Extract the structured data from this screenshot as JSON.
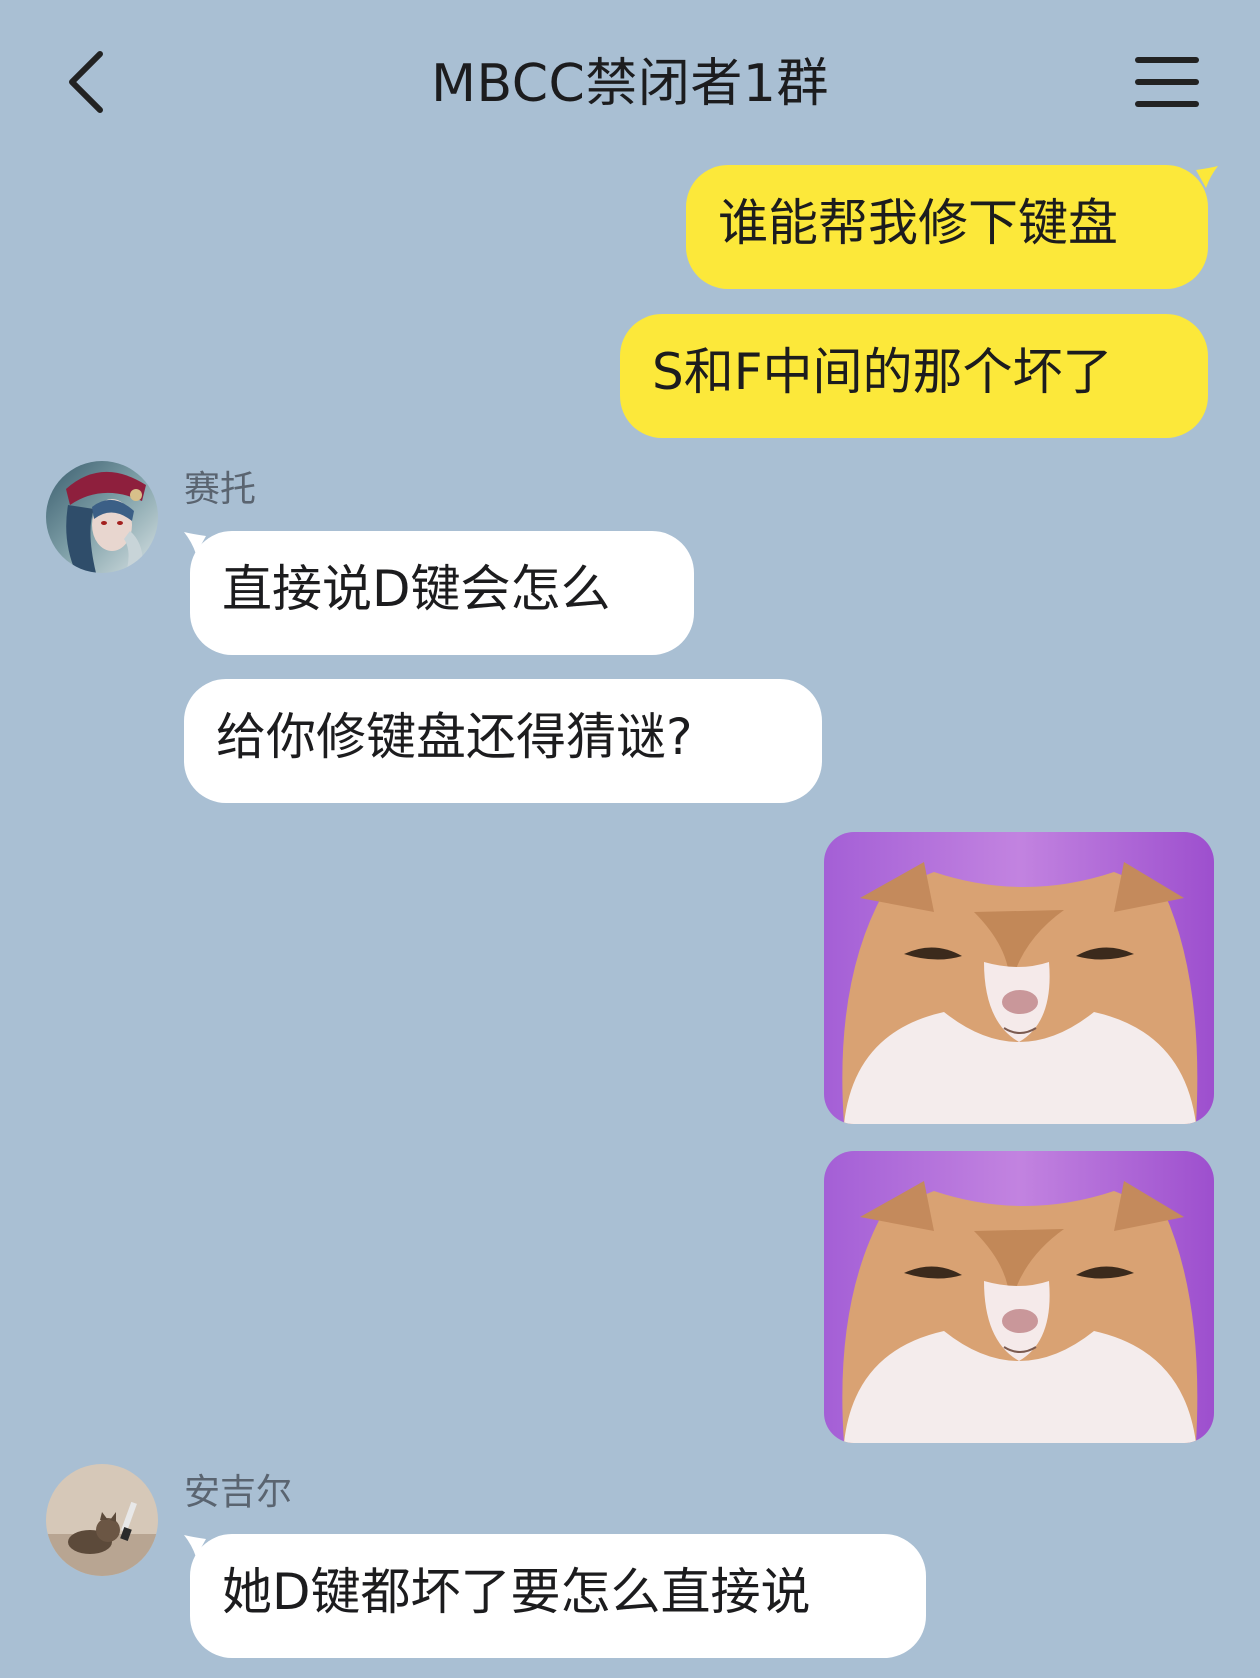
{
  "header": {
    "title": "MBCC禁闭者1群",
    "back_icon": "chevron-left-icon",
    "menu_icon": "hamburger-menu-icon"
  },
  "messages": [
    {
      "direction": "out",
      "text": "谁能帮我修下键盘"
    },
    {
      "direction": "out",
      "text": "S和F中间的那个坏了"
    },
    {
      "direction": "in",
      "sender": "赛托",
      "text": "直接说D键会怎么"
    },
    {
      "direction": "in",
      "text": "给你修键盘还得猜谜?"
    },
    {
      "direction": "out",
      "type": "sticker",
      "content": "cat-squint-sticker"
    },
    {
      "direction": "out",
      "type": "sticker",
      "content": "cat-squint-sticker"
    },
    {
      "direction": "in",
      "sender": "安吉尔",
      "text": "她D键都坏了要怎么直接说"
    }
  ],
  "colors": {
    "background": "#a9bfd3",
    "outgoing_bubble": "#fce83a",
    "incoming_bubble": "#ffffff",
    "sticker_bg": "#a45fd6"
  }
}
